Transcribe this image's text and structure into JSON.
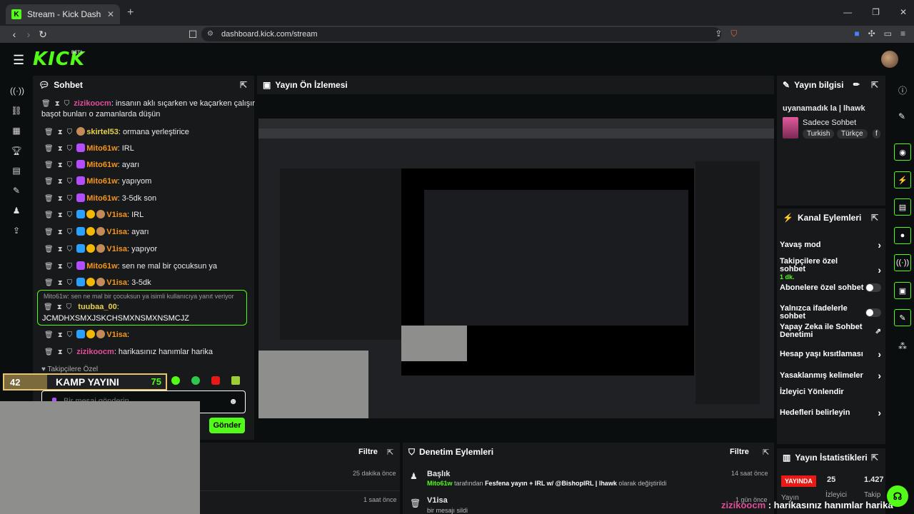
{
  "browser": {
    "tab_title": "Stream - Kick Dashboard",
    "url": "dashboard.kick.com/stream"
  },
  "app": {
    "logo": "KICK",
    "beta": "BETA"
  },
  "chat": {
    "title": "Sohbet",
    "messages": [
      {
        "user": "zizikoocm",
        "text": ": insanın aklı sıçarken ve kaçarken çalışır",
        "cont": "başot bunları o zamanlarda düşün",
        "color": "#e04e9b"
      },
      {
        "user": "skirtel53",
        "text": ": ormana yerleştirice",
        "color": "#e6d24a"
      },
      {
        "user": "Mito61w",
        "text": ": IRL",
        "color": "#f5961b"
      },
      {
        "user": "Mito61w",
        "text": ": ayarı",
        "color": "#f5961b"
      },
      {
        "user": "Mito61w",
        "text": ": yapıyom",
        "color": "#f5961b"
      },
      {
        "user": "Mito61w",
        "text": ": 3-5dk son",
        "color": "#f5961b"
      },
      {
        "user": "V1isa",
        "text": ": IRL",
        "color": "#f5961b"
      },
      {
        "user": "V1isa",
        "text": ": ayarı",
        "color": "#f5961b"
      },
      {
        "user": "V1isa",
        "text": ": yapıyor",
        "color": "#f5961b"
      },
      {
        "user": "Mito61w",
        "text": ": sen ne mal bir çocuksun ya",
        "color": "#f5961b"
      },
      {
        "user": "V1isa",
        "text": ": 3-5dk",
        "color": "#f5961b"
      }
    ],
    "reply": {
      "header": "Mito61w: sen ne mal bir çocuksun ya isimli kullanıcıya yanıt veriyor",
      "user": "tuubaa_00",
      "text": "JCMDHXSMXJSKCHSMXNSMXNSMCJZ",
      "color": "#e6d24a"
    },
    "after": [
      {
        "user": "V1isa",
        "text": ": ",
        "color": "#f5961b"
      },
      {
        "user": "zizikoocm",
        "text": ": harikasınız hanımlar harika",
        "color": "#e04e9b"
      }
    ],
    "followers_only": "Takipçilere Özel",
    "kamp_num": "42",
    "kamp_label": "KAMP YAYINI",
    "kamp_count": "75",
    "input_placeholder": "Bir mesaj gönderin",
    "send_label": "Gönder"
  },
  "preview": {
    "title": "Yayın Ön İzlemesi"
  },
  "bottom_left": {
    "filter": "Filtre",
    "rows": [
      {
        "time": "25 dakika önce"
      },
      {
        "time": "1 saat önce"
      }
    ]
  },
  "mod_actions": {
    "title": "Denetim Eylemleri",
    "filter": "Filtre",
    "rows": [
      {
        "title": "Başlık",
        "user": "Mito61w",
        "mid": " tarafından ",
        "value": "Fesfena yayın + IRL w/ @BishopIRL | lhawk",
        "tail": " olarak değiştirildi",
        "time": "14 saat önce"
      },
      {
        "title": "V1isa",
        "desc": "bir mesajı sildi",
        "time": "1 gün önce"
      }
    ]
  },
  "stream_info": {
    "title": "Yayın bilgisi",
    "stream_title": "uyanamadık la | lhawk",
    "category": "Sadece Sohbet",
    "tags": [
      "Turkish",
      "Türkçe",
      "f"
    ]
  },
  "channel_actions": {
    "title": "Kanal Eylemleri",
    "items": [
      {
        "label": "Yavaş mod",
        "control": "chevron"
      },
      {
        "label": "Takipçilere özel sohbet",
        "sub": "1 dk.",
        "control": "chevron"
      },
      {
        "label": "Abonelere özel sohbet",
        "control": "toggle"
      },
      {
        "label": "Yalnızca ifadelerle sohbet",
        "control": "toggle"
      },
      {
        "label": "Yapay Zeka ile Sohbet Denetimi",
        "control": "external"
      },
      {
        "label": "Hesap yaşı kısıtlaması",
        "control": "chevron"
      },
      {
        "label": "Yasaklanmış kelimeler",
        "control": "chevron"
      },
      {
        "label": "İzleyici Yönlendir",
        "control": "none"
      },
      {
        "label": "Hedefleri belirleyin",
        "control": "chevron"
      }
    ]
  },
  "stats": {
    "title": "Yayın İstatistikleri",
    "live_badge": "YAYINDA",
    "viewers": "25",
    "followers": "1.427",
    "labels": [
      "Yayın",
      "İzleyici",
      "Takip"
    ]
  },
  "overlay": {
    "user": "zizikoocm",
    "text": " : harikasınız hanımlar harika"
  },
  "colors": {
    "accent": "#53fc18",
    "bg": "#0b0e0f",
    "panel": "#18191b",
    "live": "#e91916"
  }
}
